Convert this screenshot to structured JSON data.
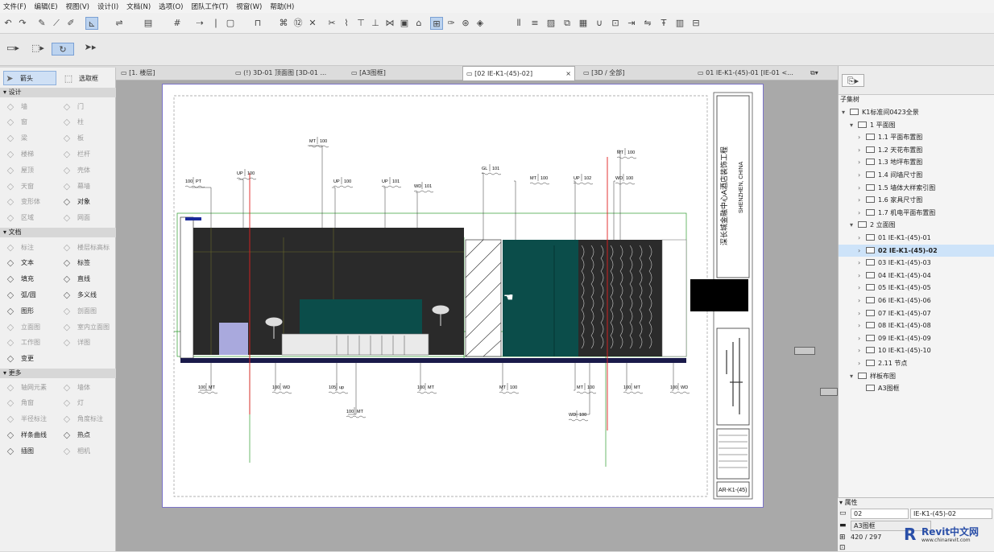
{
  "menu": [
    "文件(F)",
    "编辑(E)",
    "视图(V)",
    "设计(I)",
    "文档(N)",
    "选项(O)",
    "团队工作(T)",
    "视窗(W)",
    "帮助(H)"
  ],
  "toolbox": {
    "arrow": "箭头",
    "marquee": "选取框",
    "sections": {
      "design": "设计",
      "document": "文档",
      "more": "更多"
    },
    "design_tools": [
      {
        "icon": "wall-icon",
        "label": "墙"
      },
      {
        "icon": "door-icon",
        "label": "门"
      },
      {
        "icon": "window-icon",
        "label": "窗"
      },
      {
        "icon": "column-icon",
        "label": "柱"
      },
      {
        "icon": "beam-icon",
        "label": "梁"
      },
      {
        "icon": "slab-icon",
        "label": "板"
      },
      {
        "icon": "stair-icon",
        "label": "楼梯"
      },
      {
        "icon": "railing-icon",
        "label": "栏杆"
      },
      {
        "icon": "roof-icon",
        "label": "屋顶"
      },
      {
        "icon": "shell-icon",
        "label": "壳体"
      },
      {
        "icon": "skylight-icon",
        "label": "天窗"
      },
      {
        "icon": "curtain-wall-icon",
        "label": "幕墙"
      },
      {
        "icon": "morph-icon",
        "label": "变形体"
      },
      {
        "icon": "object-icon",
        "label": "对象"
      },
      {
        "icon": "zone-icon",
        "label": "区域"
      },
      {
        "icon": "mesh-icon",
        "label": "网面"
      }
    ],
    "doc_tools": [
      {
        "icon": "dimension-icon",
        "label": "标注"
      },
      {
        "icon": "level-dimension-icon",
        "label": "楼层标高标"
      },
      {
        "icon": "text-icon",
        "label": "文本"
      },
      {
        "icon": "label-icon",
        "label": "标签"
      },
      {
        "icon": "fill-icon",
        "label": "填充"
      },
      {
        "icon": "line-icon",
        "label": "直线"
      },
      {
        "icon": "arc-icon",
        "label": "弧/圆"
      },
      {
        "icon": "polyline-icon",
        "label": "多义线"
      },
      {
        "icon": "drawing-icon",
        "label": "图形"
      },
      {
        "icon": "section-icon",
        "label": "剖面图"
      },
      {
        "icon": "elevation-icon",
        "label": "立面图"
      },
      {
        "icon": "interior-elevation-icon",
        "label": "室内立面图"
      },
      {
        "icon": "worksheet-icon",
        "label": "工作图"
      },
      {
        "icon": "detail-icon",
        "label": "详图"
      },
      {
        "icon": "change-icon",
        "label": "变更"
      }
    ],
    "more_tools": [
      {
        "icon": "grid-element-icon",
        "label": "轴网元素"
      },
      {
        "icon": "lamp-icon",
        "label": "墙体"
      },
      {
        "icon": "corner-window-icon",
        "label": "角窗"
      },
      {
        "icon": "light-icon",
        "label": "灯"
      },
      {
        "icon": "radial-dimension-icon",
        "label": "半径标注"
      },
      {
        "icon": "angle-dimension-icon",
        "label": "角度标注"
      },
      {
        "icon": "spline-icon",
        "label": "样条曲线"
      },
      {
        "icon": "hotspot-icon",
        "label": "热点"
      },
      {
        "icon": "figure-icon",
        "label": "插图"
      },
      {
        "icon": "camera-icon",
        "label": "相机"
      }
    ]
  },
  "tabs": [
    {
      "label": "[1. 楼层]",
      "close": ""
    },
    {
      "label": "(!) 3D-01 顶面图 [3D-01 ...",
      "close": ""
    },
    {
      "label": "[A3图框]",
      "close": ""
    },
    {
      "label": "[02 IE-K1-(45)-02]",
      "close": "×"
    },
    {
      "label": "[3D / 全部]",
      "close": ""
    },
    {
      "label": "01 IE-K1-(45)-01 [IE-01 <...",
      "close": ""
    }
  ],
  "navigator": {
    "header": "子集树",
    "root": "K1标准间0423全景",
    "group1": "1 平面图",
    "plans": [
      "1.1 平面布置图",
      "1.2 天花布置图",
      "1.3 地坪布置图",
      "1.4 间墙尺寸图",
      "1.5 墙体大样索引图",
      "1.6 家具尺寸图",
      "1.7 机电平面布置图"
    ],
    "group2": "2 立面图",
    "elevations": [
      "01 IE-K1-(45)-01",
      "02 IE-K1-(45)-02",
      "03 IE-K1-(45)-03",
      "04 IE-K1-(45)-04",
      "05 IE-K1-(45)-05",
      "06 IE-K1-(45)-06",
      "07 IE-K1-(45)-07",
      "08 IE-K1-(45)-08",
      "09 IE-K1-(45)-09",
      "10 IE-K1-(45)-10",
      "2.11 节点"
    ],
    "selected_index": 1,
    "group3": "样板布图",
    "layout": "A3图框"
  },
  "properties": {
    "header": "属性",
    "id_value": "02",
    "name_value": "IE-K1-(45)-02",
    "layout_value": "A3图框",
    "size_value": "420 / 297"
  },
  "sheet": {
    "titleblock_vertical_cn": "深长城金融中心A酒店装饰工程",
    "titleblock_vertical_en": "SHENZHEN, CHINA",
    "drawing_no": "AR-K1-(45)"
  },
  "annotations_top": [
    {
      "t1": "100",
      "t2": "PT"
    },
    {
      "t1": "UP",
      "t2": "100"
    },
    {
      "t1": "MT",
      "t2": "100"
    },
    {
      "t1": "UP",
      "t2": "100"
    },
    {
      "t1": "UP",
      "t2": "101"
    },
    {
      "t1": "WD",
      "t2": "101"
    },
    {
      "t1": "GL",
      "t2": "101"
    },
    {
      "t1": "MT",
      "t2": "100"
    },
    {
      "t1": "UP",
      "t2": "102"
    },
    {
      "t1": "WD",
      "t2": "100"
    },
    {
      "t1": "MT",
      "t2": "100"
    }
  ],
  "annotations_bottom": [
    {
      "t1": "100",
      "t2": "MT"
    },
    {
      "t1": "100",
      "t2": "WD"
    },
    {
      "t1": "105",
      "t2": "up"
    },
    {
      "t1": "100",
      "t2": "MT"
    },
    {
      "t1": "100",
      "t2": "MT"
    },
    {
      "t1": "MT",
      "t2": "100"
    },
    {
      "t1": "MT",
      "t2": "100"
    },
    {
      "t1": "WD",
      "t2": "100"
    },
    {
      "t1": "100",
      "t2": "MT"
    },
    {
      "t1": "100",
      "t2": "WD"
    }
  ],
  "watermark": {
    "brand": "Revit中文网",
    "url": "www.chinarevit.com"
  },
  "colors": {
    "wall_dark": "#2a2a2a",
    "teal": "#0b4d4a",
    "accent_blue": "#2a4fa8",
    "red_line": "#e02020",
    "green_line": "#2e9a2e"
  }
}
